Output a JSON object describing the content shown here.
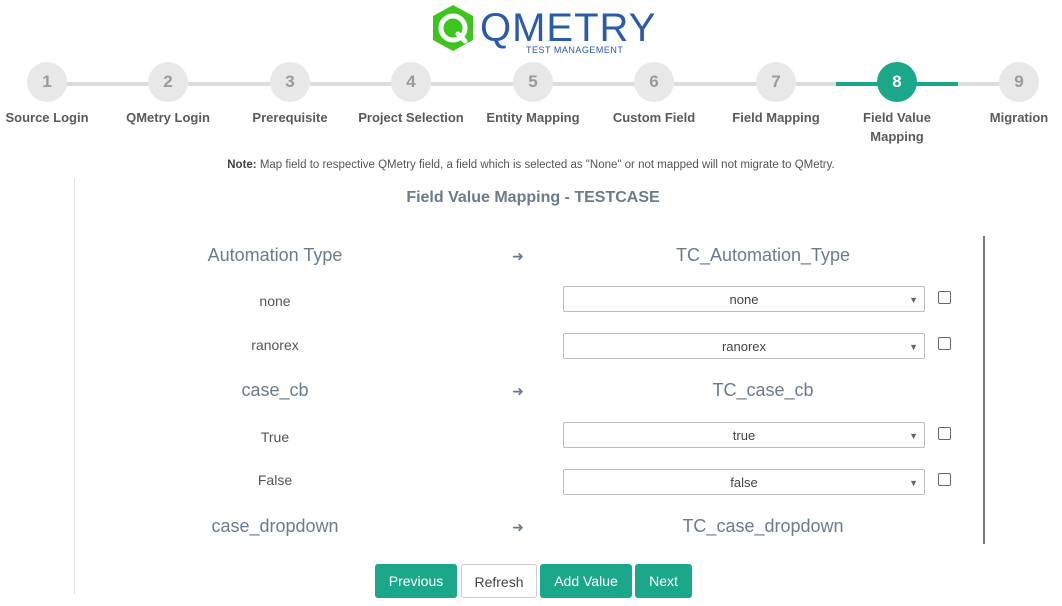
{
  "logo": {
    "word": "QMETRY",
    "sub": "TEST MANAGEMENT"
  },
  "steps": [
    {
      "num": "1",
      "label": "Source Login"
    },
    {
      "num": "2",
      "label": "QMetry Login"
    },
    {
      "num": "3",
      "label": "Prerequisite"
    },
    {
      "num": "4",
      "label": "Project Selection"
    },
    {
      "num": "5",
      "label": "Entity Mapping"
    },
    {
      "num": "6",
      "label": "Custom Field"
    },
    {
      "num": "7",
      "label": "Field Mapping"
    },
    {
      "num": "8",
      "label": "Field Value Mapping"
    },
    {
      "num": "9",
      "label": "Migration"
    }
  ],
  "active_step": "8",
  "note": {
    "prefix": "Note:",
    "text": " Map field to respective QMetry field, a field which is selected as \"None\" or not mapped will not migrate to QMetry."
  },
  "section_title": "Field Value Mapping - TESTCASE",
  "mappings": [
    {
      "source": "Automation Type",
      "target": "TC_Automation_Type",
      "values": [
        {
          "source": "none",
          "selected": "none",
          "checked": false
        },
        {
          "source": "ranorex",
          "selected": "ranorex",
          "checked": false
        }
      ]
    },
    {
      "source": "case_cb",
      "target": "TC_case_cb",
      "values": [
        {
          "source": "True",
          "selected": "true",
          "checked": false
        },
        {
          "source": "False",
          "selected": "false",
          "checked": false
        }
      ]
    },
    {
      "source": "case_dropdown",
      "target": "TC_case_dropdown",
      "values": []
    }
  ],
  "buttons": {
    "previous": "Previous",
    "refresh": "Refresh",
    "add_value": "Add Value",
    "next": "Next"
  },
  "colors": {
    "accent": "#1aa78a",
    "brand": "#2b5aa7",
    "logo_green": "#3ec41e"
  },
  "icons": {
    "arrow": "arrow-right-icon",
    "caret": "caret-down-icon"
  }
}
